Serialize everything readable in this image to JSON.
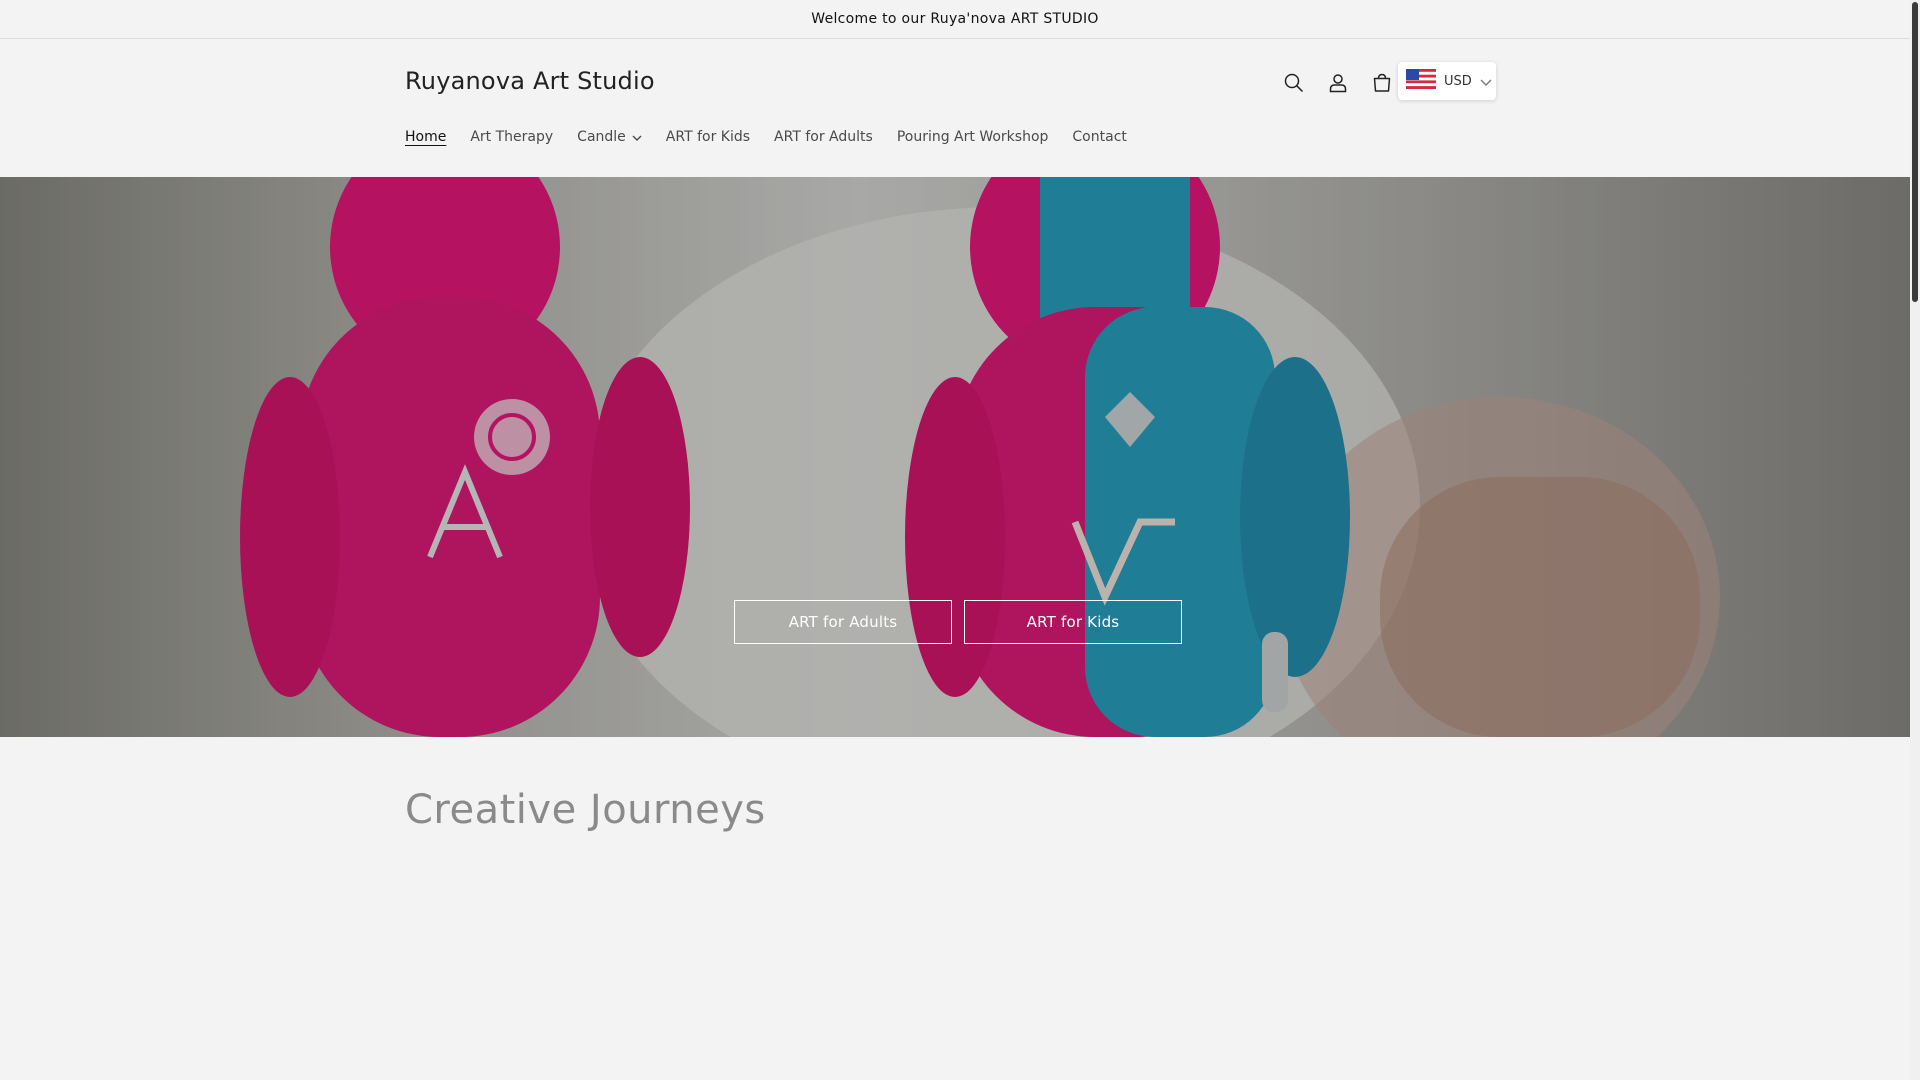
{
  "announcement": {
    "text": "Welcome to our Ruya'nova ART STUDIO"
  },
  "header": {
    "logo": "Ruyanova Art Studio",
    "nav": [
      {
        "label": "Home",
        "active": true
      },
      {
        "label": "Art Therapy"
      },
      {
        "label": "Candle",
        "has_dropdown": true
      },
      {
        "label": "ART for Kids"
      },
      {
        "label": "ART for Adults"
      },
      {
        "label": "Pouring Art Workshop"
      },
      {
        "label": "Contact"
      }
    ],
    "icons": [
      "search-icon",
      "account-icon",
      "cart-icon"
    ],
    "currency": {
      "code": "USD",
      "flag": "us-flag-icon"
    }
  },
  "hero": {
    "buttons": [
      {
        "label": "ART for Adults"
      },
      {
        "label": "ART for Kids"
      }
    ],
    "colors": {
      "pink": "#e8187d",
      "teal": "#2aa0c0"
    }
  },
  "section": {
    "title": "Creative Journeys"
  }
}
